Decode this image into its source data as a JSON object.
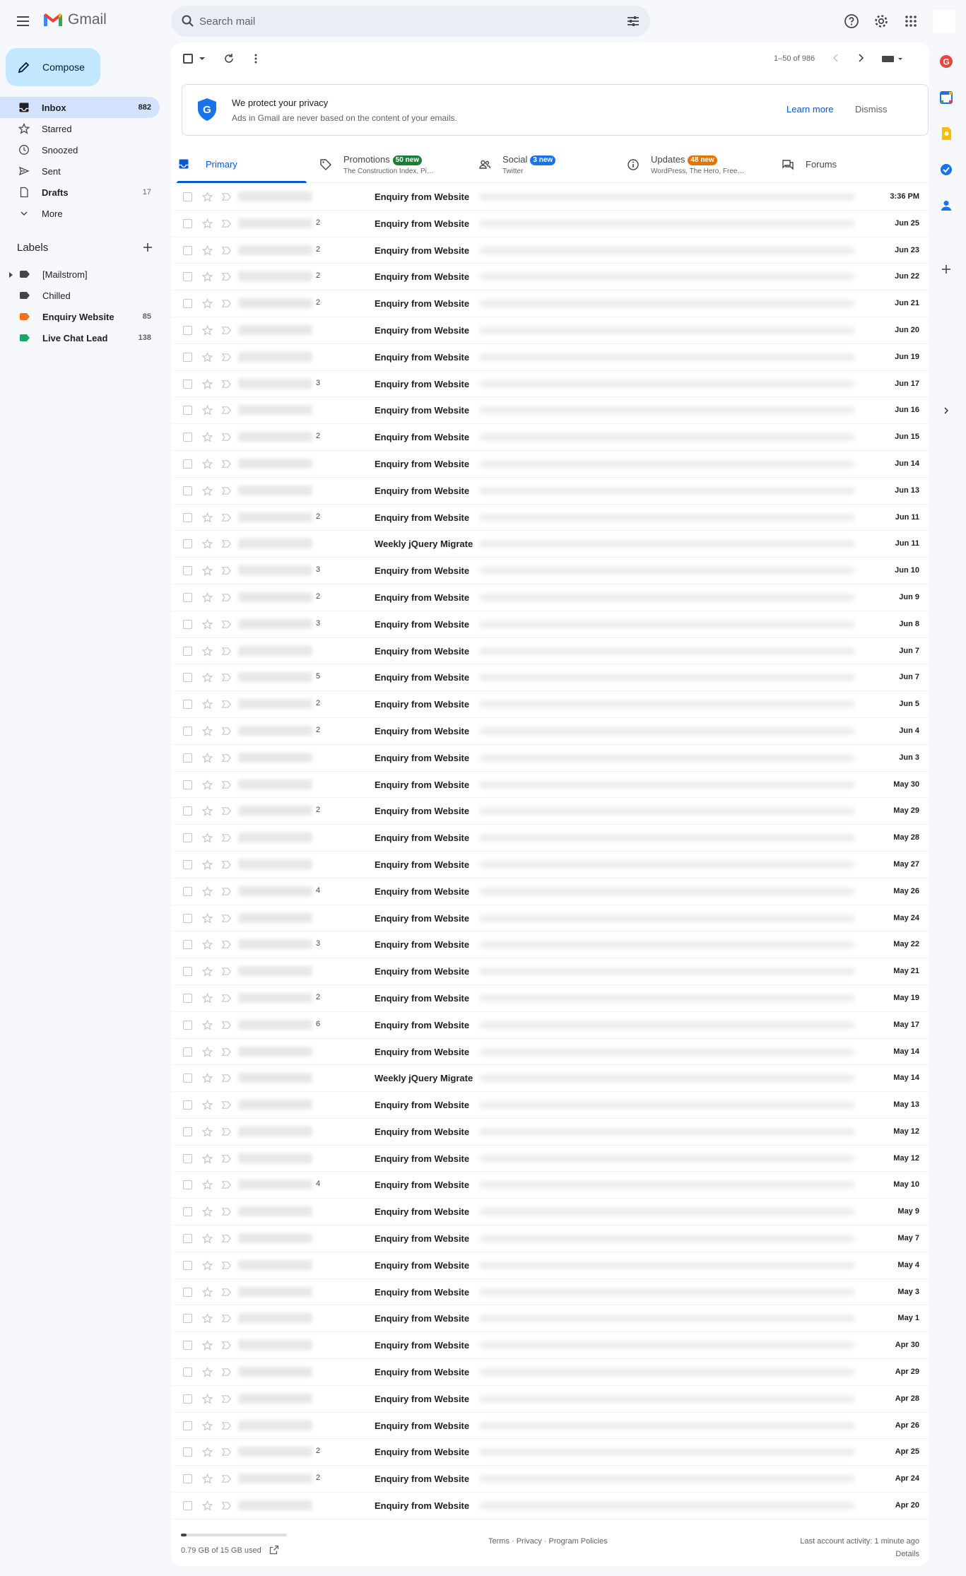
{
  "app": {
    "logo_text": "Gmail"
  },
  "search": {
    "placeholder": "Search mail"
  },
  "compose": {
    "label": "Compose"
  },
  "nav": [
    {
      "label": "Inbox",
      "count": "882",
      "icon": "inbox-icon",
      "active": true
    },
    {
      "label": "Starred",
      "count": "",
      "icon": "star-icon"
    },
    {
      "label": "Snoozed",
      "count": "",
      "icon": "clock-icon"
    },
    {
      "label": "Sent",
      "count": "",
      "icon": "send-icon"
    },
    {
      "label": "Drafts",
      "count": "17",
      "icon": "draft-icon",
      "bold": true
    },
    {
      "label": "More",
      "count": "",
      "icon": "chevron-down-icon"
    }
  ],
  "labels": {
    "heading": "Labels",
    "items": [
      {
        "label": "[Mailstrom]",
        "count": "",
        "color": "#444746"
      },
      {
        "label": "Chilled",
        "count": "",
        "color": "#444746"
      },
      {
        "label": "Enquiry Website",
        "count": "85",
        "color": "#f2711c",
        "bold": true
      },
      {
        "label": "Live Chat Lead",
        "count": "138",
        "color": "#16a765",
        "bold": true
      }
    ]
  },
  "toolbar": {
    "pager": "1–50 of 986"
  },
  "privacy": {
    "title": "We protect your privacy",
    "subtitle": "Ads in Gmail are never based on the content of your emails.",
    "learn_more": "Learn more",
    "dismiss": "Dismiss"
  },
  "tabs": [
    {
      "name": "Primary",
      "badge": "",
      "sub": "",
      "active": true,
      "icon": "inbox-icon"
    },
    {
      "name": "Promotions",
      "badge": "50 new",
      "badge_color": "#188038",
      "sub": "The Construction Index, Pi…",
      "icon": "tag-icon"
    },
    {
      "name": "Social",
      "badge": "3 new",
      "badge_color": "#1a73e8",
      "sub": "Twitter",
      "icon": "people-icon"
    },
    {
      "name": "Updates",
      "badge": "48 new",
      "badge_color": "#e37400",
      "sub": "WordPress, The Hero, Free…",
      "icon": "info-icon"
    },
    {
      "name": "Forums",
      "badge": "",
      "sub": "",
      "icon": "forum-icon"
    }
  ],
  "emails": [
    {
      "count": "",
      "subject": "Enquiry from Website",
      "date": "3:36 PM"
    },
    {
      "count": "2",
      "subject": "Enquiry from Website",
      "date": "Jun 25"
    },
    {
      "count": "2",
      "subject": "Enquiry from Website",
      "date": "Jun 23"
    },
    {
      "count": "2",
      "subject": "Enquiry from Website",
      "date": "Jun 22"
    },
    {
      "count": "2",
      "subject": "Enquiry from Website",
      "date": "Jun 21"
    },
    {
      "count": "",
      "subject": "Enquiry from Website",
      "date": "Jun 20"
    },
    {
      "count": "",
      "subject": "Enquiry from Website",
      "date": "Jun 19"
    },
    {
      "count": "3",
      "subject": "Enquiry from Website",
      "date": "Jun 17"
    },
    {
      "count": "",
      "subject": "Enquiry from Website",
      "date": "Jun 16"
    },
    {
      "count": "2",
      "subject": "Enquiry from Website",
      "date": "Jun 15"
    },
    {
      "count": "",
      "subject": "Enquiry from Website",
      "date": "Jun 14"
    },
    {
      "count": "",
      "subject": "Enquiry from Website",
      "date": "Jun 13"
    },
    {
      "count": "2",
      "subject": "Enquiry from Website",
      "date": "Jun 11"
    },
    {
      "count": "",
      "subject": "Weekly jQuery Migrate",
      "date": "Jun 11"
    },
    {
      "count": "3",
      "subject": "Enquiry from Website",
      "date": "Jun 10"
    },
    {
      "count": "2",
      "subject": "Enquiry from Website",
      "date": "Jun 9"
    },
    {
      "count": "3",
      "subject": "Enquiry from Website",
      "date": "Jun 8"
    },
    {
      "count": "",
      "subject": "Enquiry from Website",
      "date": "Jun 7"
    },
    {
      "count": "5",
      "subject": "Enquiry from Website",
      "date": "Jun 7"
    },
    {
      "count": "2",
      "subject": "Enquiry from Website",
      "date": "Jun 5"
    },
    {
      "count": "2",
      "subject": "Enquiry from Website",
      "date": "Jun 4"
    },
    {
      "count": "",
      "subject": "Enquiry from Website",
      "date": "Jun 3"
    },
    {
      "count": "",
      "subject": "Enquiry from Website",
      "date": "May 30"
    },
    {
      "count": "2",
      "subject": "Enquiry from Website",
      "date": "May 29"
    },
    {
      "count": "",
      "subject": "Enquiry from Website",
      "date": "May 28"
    },
    {
      "count": "",
      "subject": "Enquiry from Website",
      "date": "May 27"
    },
    {
      "count": "4",
      "subject": "Enquiry from Website",
      "date": "May 26"
    },
    {
      "count": "",
      "subject": "Enquiry from Website",
      "date": "May 24"
    },
    {
      "count": "3",
      "subject": "Enquiry from Website",
      "date": "May 22"
    },
    {
      "count": "",
      "subject": "Enquiry from Website",
      "date": "May 21"
    },
    {
      "count": "2",
      "subject": "Enquiry from Website",
      "date": "May 19"
    },
    {
      "count": "6",
      "subject": "Enquiry from Website",
      "date": "May 17"
    },
    {
      "count": "",
      "subject": "Enquiry from Website",
      "date": "May 14"
    },
    {
      "count": "",
      "subject": "Weekly jQuery Migrate",
      "date": "May 14"
    },
    {
      "count": "",
      "subject": "Enquiry from Website",
      "date": "May 13"
    },
    {
      "count": "",
      "subject": "Enquiry from Website",
      "date": "May 12"
    },
    {
      "count": "",
      "subject": "Enquiry from Website",
      "date": "May 12"
    },
    {
      "count": "4",
      "subject": "Enquiry from Website",
      "date": "May 10"
    },
    {
      "count": "",
      "subject": "Enquiry from Website",
      "date": "May 9"
    },
    {
      "count": "",
      "subject": "Enquiry from Website",
      "date": "May 7"
    },
    {
      "count": "",
      "subject": "Enquiry from Website",
      "date": "May 4"
    },
    {
      "count": "",
      "subject": "Enquiry from Website",
      "date": "May 3"
    },
    {
      "count": "",
      "subject": "Enquiry from Website",
      "date": "May 1"
    },
    {
      "count": "",
      "subject": "Enquiry from Website",
      "date": "Apr 30"
    },
    {
      "count": "",
      "subject": "Enquiry from Website",
      "date": "Apr 29"
    },
    {
      "count": "",
      "subject": "Enquiry from Website",
      "date": "Apr 28"
    },
    {
      "count": "",
      "subject": "Enquiry from Website",
      "date": "Apr 26"
    },
    {
      "count": "2",
      "subject": "Enquiry from Website",
      "date": "Apr 25"
    },
    {
      "count": "2",
      "subject": "Enquiry from Website",
      "date": "Apr 24"
    },
    {
      "count": "",
      "subject": "Enquiry from Website",
      "date": "Apr 20"
    }
  ],
  "footer": {
    "storage": "0.79 GB of 15 GB used",
    "storage_fraction": 0.053,
    "links": "Terms · Privacy · Program Policies",
    "activity": "Last account activity: 1 minute ago",
    "details": "Details"
  },
  "colors": {
    "accent": "#0b57d0",
    "compose_bg": "#c2e7ff",
    "active_nav": "#d3e3fd"
  }
}
